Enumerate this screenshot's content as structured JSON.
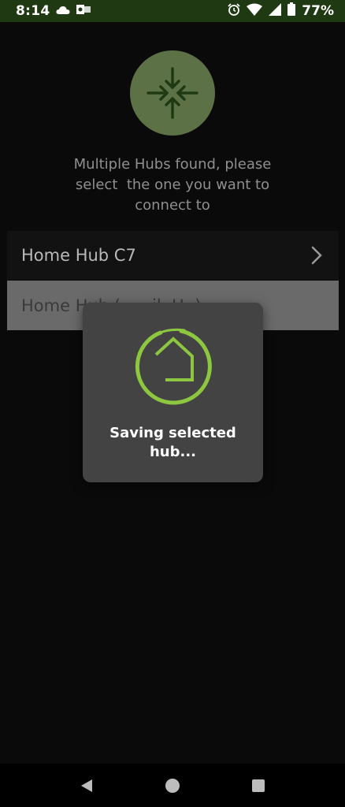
{
  "status_bar": {
    "time": "8:14",
    "battery_percent": "77%",
    "icons": [
      "cloud-icon",
      "outlook-icon",
      "alarm-icon",
      "wifi-icon",
      "signal-icon",
      "battery-icon"
    ]
  },
  "header": {
    "icon": "collapse-arrows-icon"
  },
  "prompt": {
    "line1": "Multiple Hubs found, please",
    "line2": "select  the one you want to",
    "line3": "connect to"
  },
  "hubs": [
    {
      "label": "Home Hub C7"
    },
    {
      "label": "Home Hub (      il  H  )"
    }
  ],
  "dialog": {
    "icon": "home-logo-icon",
    "message": "Saving selected hub..."
  },
  "nav": {
    "icons": [
      "back-icon",
      "home-icon",
      "recents-icon"
    ]
  },
  "colors": {
    "status_bar_bg": "#1f3a12",
    "accent_green": "#8dc63f",
    "header_circle": "#5d7147",
    "dialog_bg": "#434343"
  }
}
